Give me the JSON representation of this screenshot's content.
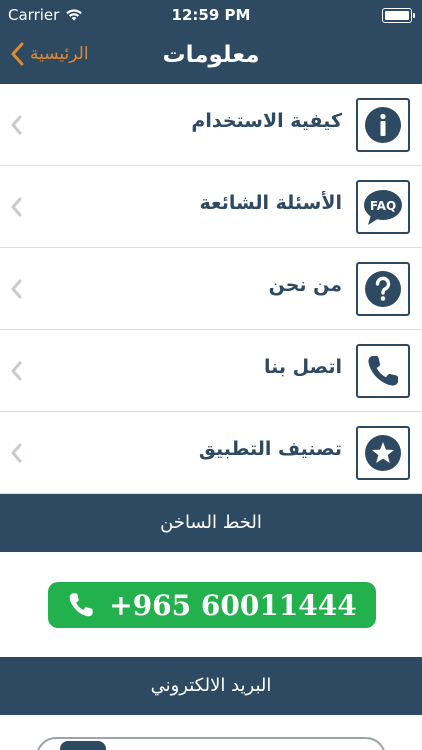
{
  "status_bar": {
    "carrier": "Carrier",
    "time": "12:59 PM"
  },
  "nav": {
    "title": "معلومات",
    "back_label": "الرئيسية"
  },
  "menu": [
    {
      "label": "كيفية الاستخدام",
      "icon": "info-icon"
    },
    {
      "label": "الأسئلة الشائعة",
      "icon": "faq-icon",
      "icon_text": "FAQ"
    },
    {
      "label": "من نحن",
      "icon": "question-icon"
    },
    {
      "label": "اتصل بنا",
      "icon": "phone-icon"
    },
    {
      "label": "تصنيف التطبيق",
      "icon": "star-icon"
    }
  ],
  "hotline": {
    "header": "الخط الساخن",
    "number": "+965 60011444"
  },
  "email": {
    "header": "البريد الالكتروني"
  },
  "colors": {
    "primary": "#2e4a62",
    "accent": "#e08a2c",
    "green": "#22b14c"
  }
}
